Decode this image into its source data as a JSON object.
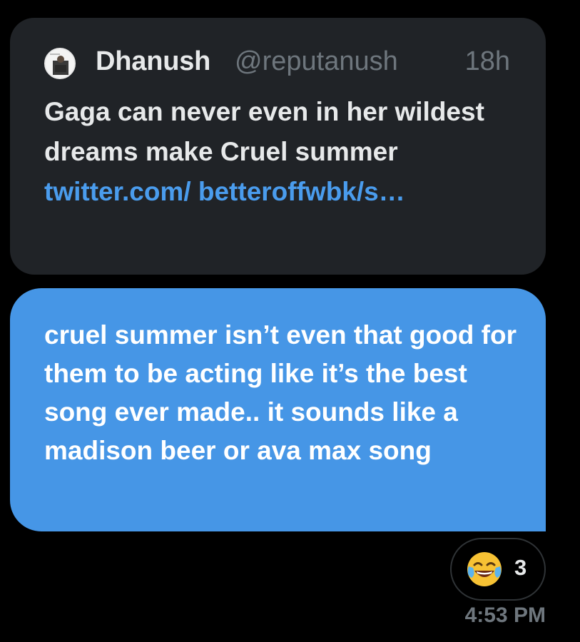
{
  "quoted_tweet": {
    "author_name": "Dhanush",
    "author_handle": "@reputanush",
    "time_ago": "18h",
    "text": "Gaga can never even in her wildest dreams make Cruel summer",
    "link_text": "twitter.com/ betteroffwbk/s…",
    "avatar_icon": "profile-photo-icon"
  },
  "message": {
    "text": "cruel summer isn’t even that good for them to be acting like it’s the best song ever made.. it sounds like a madison beer or ava max song",
    "bubble_color": "#4696e6"
  },
  "reaction": {
    "emoji_icon": "face-with-tears-of-joy-icon",
    "count": "3"
  },
  "timestamp": "4:53 PM",
  "colors": {
    "background": "#000000",
    "card": "#202327",
    "link": "#4a9ced",
    "secondary_text": "#6e767d",
    "primary_text": "#e7e9ea"
  }
}
